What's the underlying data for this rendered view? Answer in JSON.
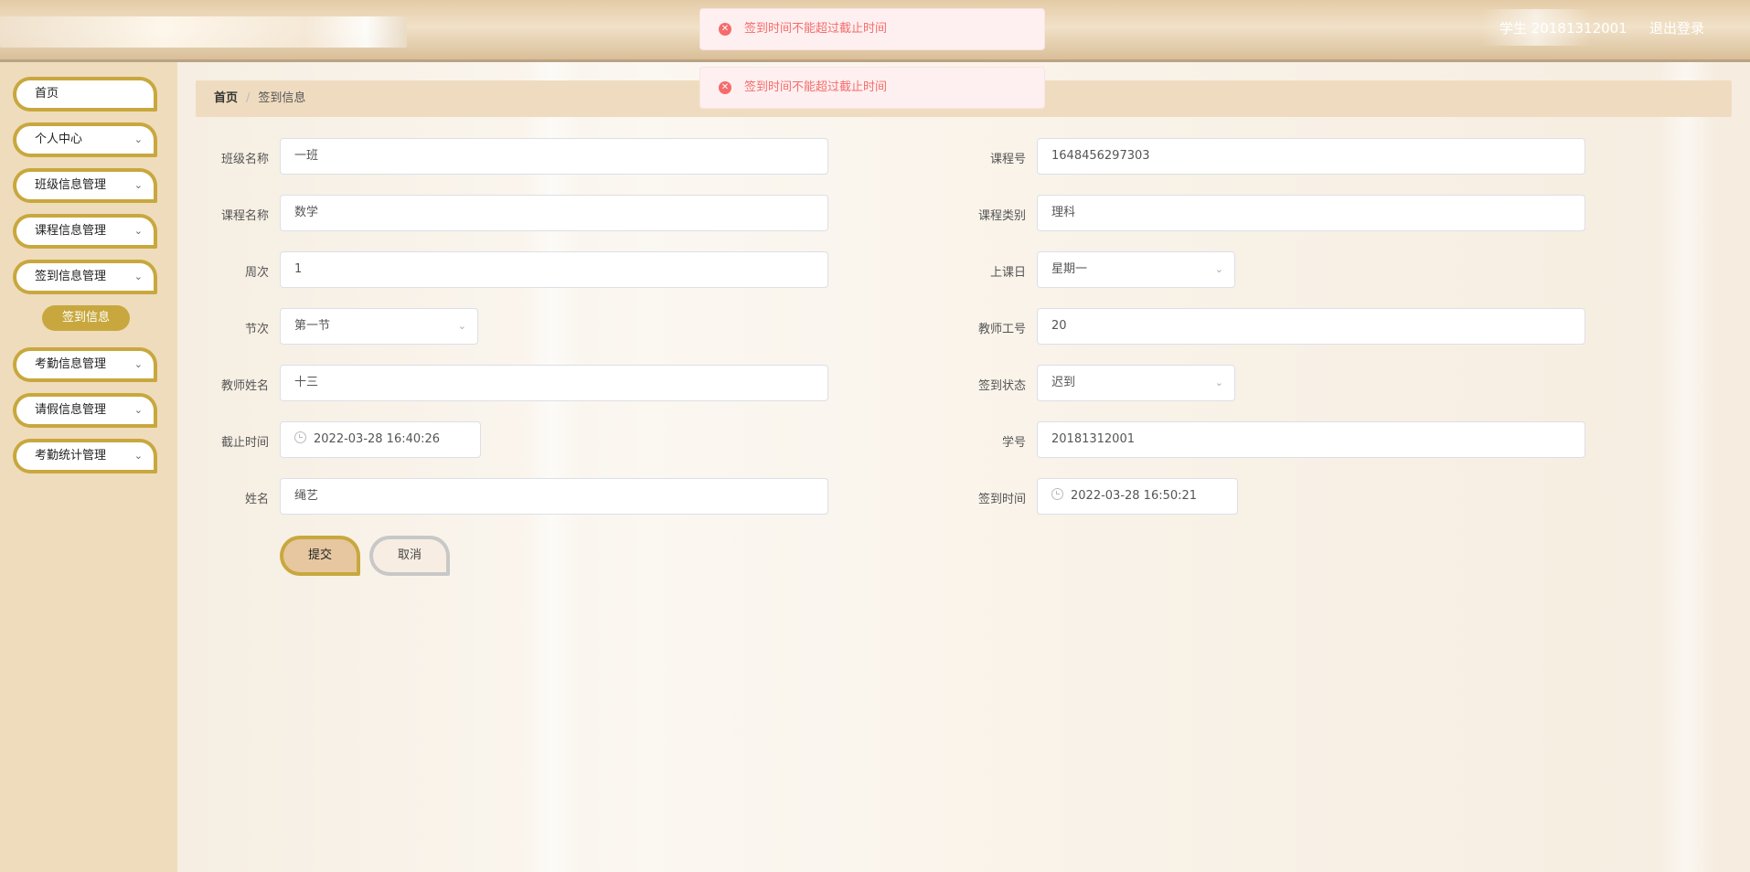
{
  "header": {
    "user_label": "学生 20181312001",
    "logout_label": "退出登录"
  },
  "sidebar": {
    "items": [
      {
        "label": "首页"
      },
      {
        "label": "个人中心"
      },
      {
        "label": "班级信息管理"
      },
      {
        "label": "课程信息管理"
      },
      {
        "label": "签到信息管理"
      },
      {
        "label": "考勤信息管理"
      },
      {
        "label": "请假信息管理"
      },
      {
        "label": "考勤统计管理"
      }
    ],
    "sub_item": "签到信息"
  },
  "breadcrumb": {
    "home": "首页",
    "separator": "/",
    "current": "签到信息"
  },
  "form": {
    "class_name": {
      "label": "班级名称",
      "value": "一班"
    },
    "course_no": {
      "label": "课程号",
      "value": "1648456297303"
    },
    "course_name": {
      "label": "课程名称",
      "value": "数学"
    },
    "course_type": {
      "label": "课程类别",
      "value": "理科"
    },
    "week": {
      "label": "周次",
      "value": "1"
    },
    "class_day": {
      "label": "上课日",
      "value": "星期一"
    },
    "section": {
      "label": "节次",
      "value": "第一节"
    },
    "teacher_no": {
      "label": "教师工号",
      "value": "20"
    },
    "teacher_name": {
      "label": "教师姓名",
      "value": "十三"
    },
    "signin_status": {
      "label": "签到状态",
      "value": "迟到"
    },
    "deadline": {
      "label": "截止时间",
      "value": "2022-03-28 16:40:26"
    },
    "student_no": {
      "label": "学号",
      "value": "20181312001"
    },
    "name": {
      "label": "姓名",
      "value": "绳艺"
    },
    "signin_time": {
      "label": "签到时间",
      "value": "2022-03-28 16:50:21"
    }
  },
  "buttons": {
    "submit": "提交",
    "cancel": "取消"
  },
  "messages": [
    "签到时间不能超过截止时间",
    "签到时间不能超过截止时间"
  ],
  "colors": {
    "accent": "#c8a83e",
    "error": "#f56c6c",
    "sidebar_bg": "#efdcbc"
  }
}
